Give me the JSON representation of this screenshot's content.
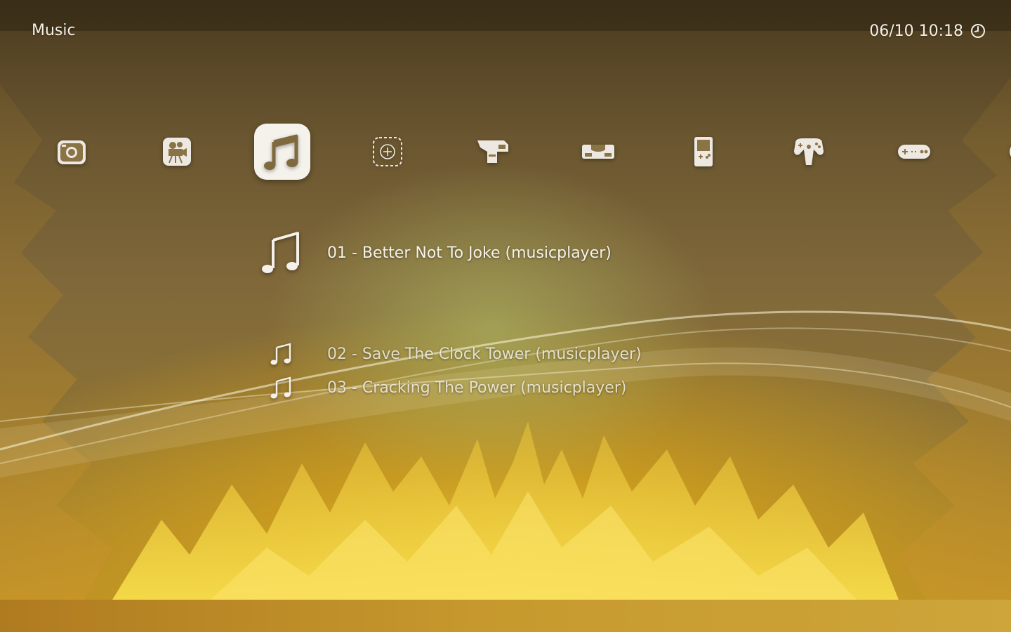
{
  "header": {
    "title": "Music",
    "datetime": "06/10 10:18",
    "clock_icon": "clock-icon"
  },
  "categories": [
    {
      "name": "images",
      "icon": "camera-icon",
      "active": false
    },
    {
      "name": "video",
      "icon": "film-camera-icon",
      "active": false
    },
    {
      "name": "music",
      "icon": "music-note-icon",
      "active": true
    },
    {
      "name": "add",
      "icon": "add-content-icon",
      "active": false
    },
    {
      "name": "arcade",
      "icon": "arcade-machine-icon",
      "active": false
    },
    {
      "name": "console",
      "icon": "retro-console-icon",
      "active": false
    },
    {
      "name": "handheld",
      "icon": "handheld-console-icon",
      "active": false
    },
    {
      "name": "n64",
      "icon": "n64-controller-icon",
      "active": false
    },
    {
      "name": "gamepad",
      "icon": "gamepad-icon",
      "active": false
    }
  ],
  "items": [
    {
      "label": "01 - Better Not To Joke (musicplayer)",
      "selected": true
    },
    {
      "label": "02 - Save The Clock Tower (musicplayer)",
      "selected": false
    },
    {
      "label": "03 - Cracking The Power (musicplayer)",
      "selected": false
    }
  ],
  "colors": {
    "text": "#f4f0e6",
    "accent": "#f5f2ec"
  }
}
